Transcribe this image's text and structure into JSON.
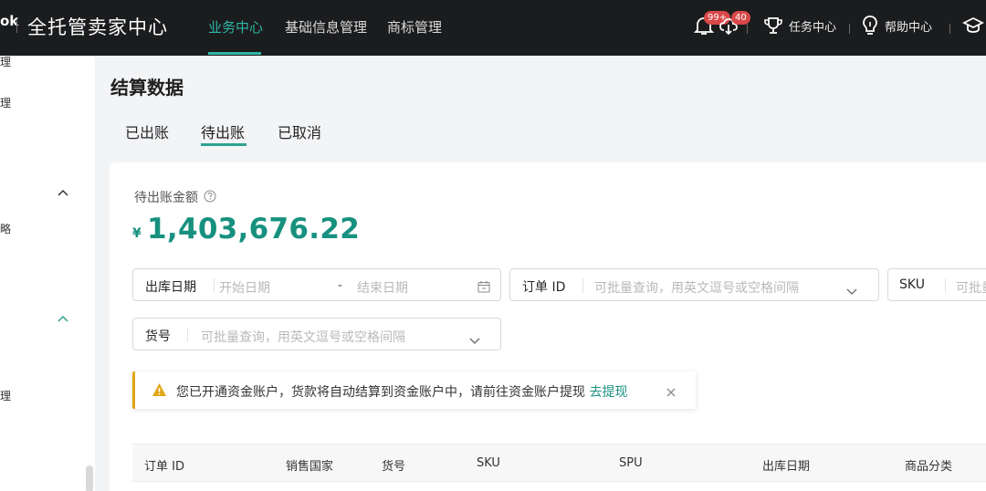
{
  "header": {
    "brand_fragment": "ok",
    "brand_title": "全托管卖家中心",
    "nav": [
      "业务中心",
      "基础信息管理",
      "商标管理"
    ],
    "notifications_badge": "99+",
    "sync_badge": "40",
    "task_center": "任务中心",
    "help_center": "帮助中心"
  },
  "sidebar": {
    "items": [
      "理",
      "理",
      "略",
      "理"
    ]
  },
  "page": {
    "title": "结算数据",
    "tabs": [
      "已出账",
      "待出账",
      "已取消"
    ],
    "active_tab": "待出账"
  },
  "summary": {
    "label": "待出账金额",
    "currency": "¥",
    "amount": "1,403,676.22"
  },
  "filters": {
    "date_label": "出库日期",
    "start_placeholder": "开始日期",
    "range_sep": "-",
    "end_placeholder": "结束日期",
    "order_label": "订单 ID",
    "order_placeholder": "可批量查询，用英文逗号或空格间隔",
    "sku_label": "SKU",
    "sku_placeholder": "可批量",
    "item_label": "货号",
    "item_placeholder": "可批量查询，用英文逗号或空格间隔"
  },
  "notice": {
    "text": "您已开通资金账户，货款将自动结算到资金账户中，请前往资金账户提现",
    "link": "去提现"
  },
  "table": {
    "columns": [
      "订单 ID",
      "销售国家",
      "货号",
      "SKU",
      "SPU",
      "出库日期",
      "商品分类"
    ]
  },
  "colors": {
    "accent": "#17917f",
    "nav_active": "#2fb6a5",
    "warning": "#e2a516",
    "badge": "#d94848"
  }
}
